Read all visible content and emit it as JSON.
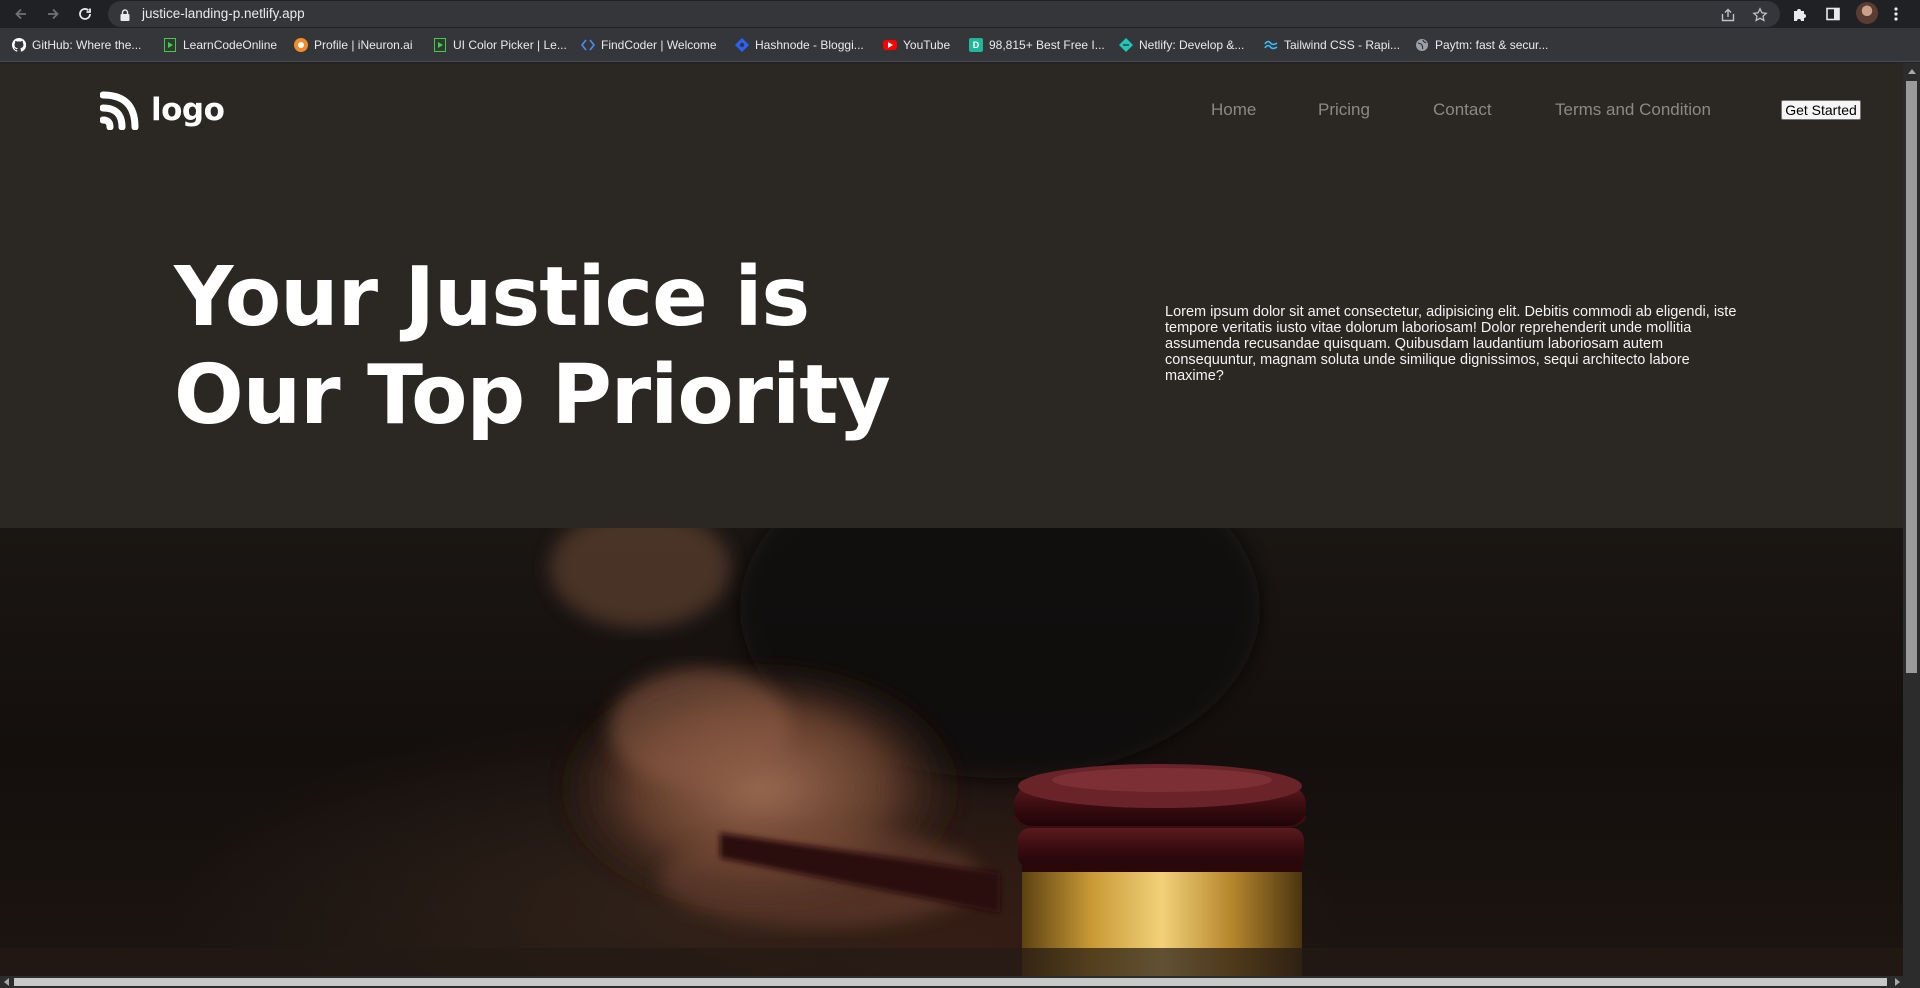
{
  "browser": {
    "url": "justice-landing-p.netlify.app",
    "icons": [
      "back-arrow-icon",
      "forward-arrow-icon",
      "reload-icon",
      "lock-icon",
      "share-icon",
      "star-icon",
      "extensions-puzzle-icon",
      "side-panel-icon",
      "profile-avatar",
      "kebab-menu-icon"
    ]
  },
  "bookmarks": [
    {
      "label": "GitHub: Where the...",
      "icon": "github-icon",
      "color": "#ffffff"
    },
    {
      "label": "LearnCodeOnline",
      "icon": "play-square-icon",
      "color": "#3ecf3e"
    },
    {
      "label": "Profile | iNeuron.ai",
      "icon": "ineuron-icon",
      "color": "#f28c28"
    },
    {
      "label": "UI Color Picker | Le...",
      "icon": "play-square-icon",
      "color": "#3ecf3e"
    },
    {
      "label": "FindCoder | Welcome",
      "icon": "code-brackets-icon",
      "color": "#4c8bf5"
    },
    {
      "label": "Hashnode - Bloggi...",
      "icon": "hashnode-icon",
      "color": "#2962ff"
    },
    {
      "label": "YouTube",
      "icon": "youtube-icon",
      "color": "#ff0000"
    },
    {
      "label": "98,815+ Best Free I...",
      "icon": "d-square-icon",
      "color": "#1fb79a"
    },
    {
      "label": "Netlify: Develop &...",
      "icon": "netlify-icon",
      "color": "#20c6b7"
    },
    {
      "label": "Tailwind CSS - Rapi...",
      "icon": "tailwind-icon",
      "color": "#38bdf8"
    },
    {
      "label": "Paytm: fast & secur...",
      "icon": "globe-icon",
      "color": "#9aa0a6"
    }
  ],
  "site": {
    "logo_text": "logo",
    "nav": [
      "Home",
      "Pricing",
      "Contact",
      "Terms and Condition"
    ],
    "cta_label": "Get Started",
    "hero_title_line1": "Your Justice is",
    "hero_title_line2": "Our Top Priority",
    "hero_text": "Lorem ipsum dolor sit amet consectetur, adipisicing elit. Debitis commodi ab eligendi, iste tempore veritatis iusto vitae dolorum laboriosam! Dolor reprehenderit unde mollitia assumenda recusandae quisquam. Quibusdam laudantium laboriosam autem consequuntur, magnam soluta unde similique dignissimos, sequi architecto labore maxime?",
    "hero_image": "judge-gavel-photo"
  },
  "colors": {
    "page_bg": "#2b2823",
    "nav_text": "#8a8984",
    "heading": "#ffffff"
  }
}
